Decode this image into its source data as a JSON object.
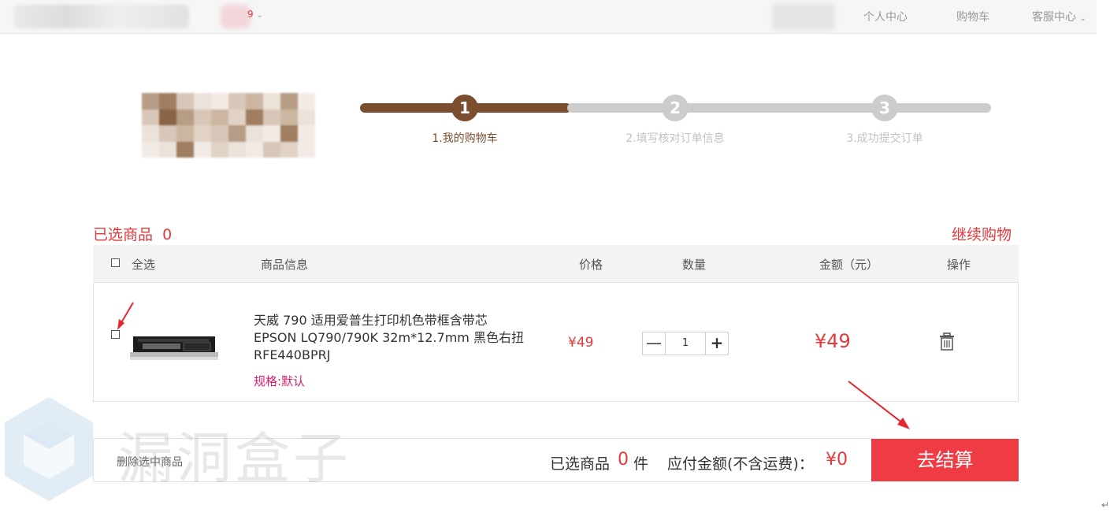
{
  "topbar": {
    "badge": "9",
    "chevron": "⌄",
    "links": [
      "个人中心",
      "购物车",
      "客服中心"
    ],
    "service_chevron": "⌄"
  },
  "steps": [
    {
      "number": "1",
      "label": "1.我的购物车",
      "active": true
    },
    {
      "number": "2",
      "label": "2.填写核对订单信息",
      "active": false
    },
    {
      "number": "3",
      "label": "3.成功提交订单",
      "active": false
    }
  ],
  "colors": {
    "step_active": "#7a4e2e",
    "step_inactive": "#cccccc",
    "accent": "#e4393c",
    "checkout": "#ef3b43",
    "spec": "#d81e6c"
  },
  "cart": {
    "selected_label": "已选商品",
    "selected_count": "0",
    "continue_shopping": "继续购物",
    "header": {
      "select_all": "全选",
      "product_info": "商品信息",
      "price": "价格",
      "quantity": "数量",
      "amount": "金额（元）",
      "action": "操作"
    },
    "items": [
      {
        "title": "天威 790 适用爱普生打印机色带框含带芯 EPSON LQ790/790K 32m*12.7mm 黑色右扭 RFE440BPRJ",
        "spec": "规格:默认",
        "price": "¥49",
        "quantity": "1",
        "amount": "¥49",
        "minus": "—",
        "plus": "+"
      }
    ]
  },
  "footer": {
    "delete_selected": "删除选中商品",
    "selected_label": "已选商品",
    "selected_count": "0",
    "unit": "件",
    "payable_label": "应付金额(不含运费)：",
    "payable_value": "¥0",
    "checkout": "去结算"
  },
  "watermark": "漏洞盒子",
  "return_mark": "↵"
}
